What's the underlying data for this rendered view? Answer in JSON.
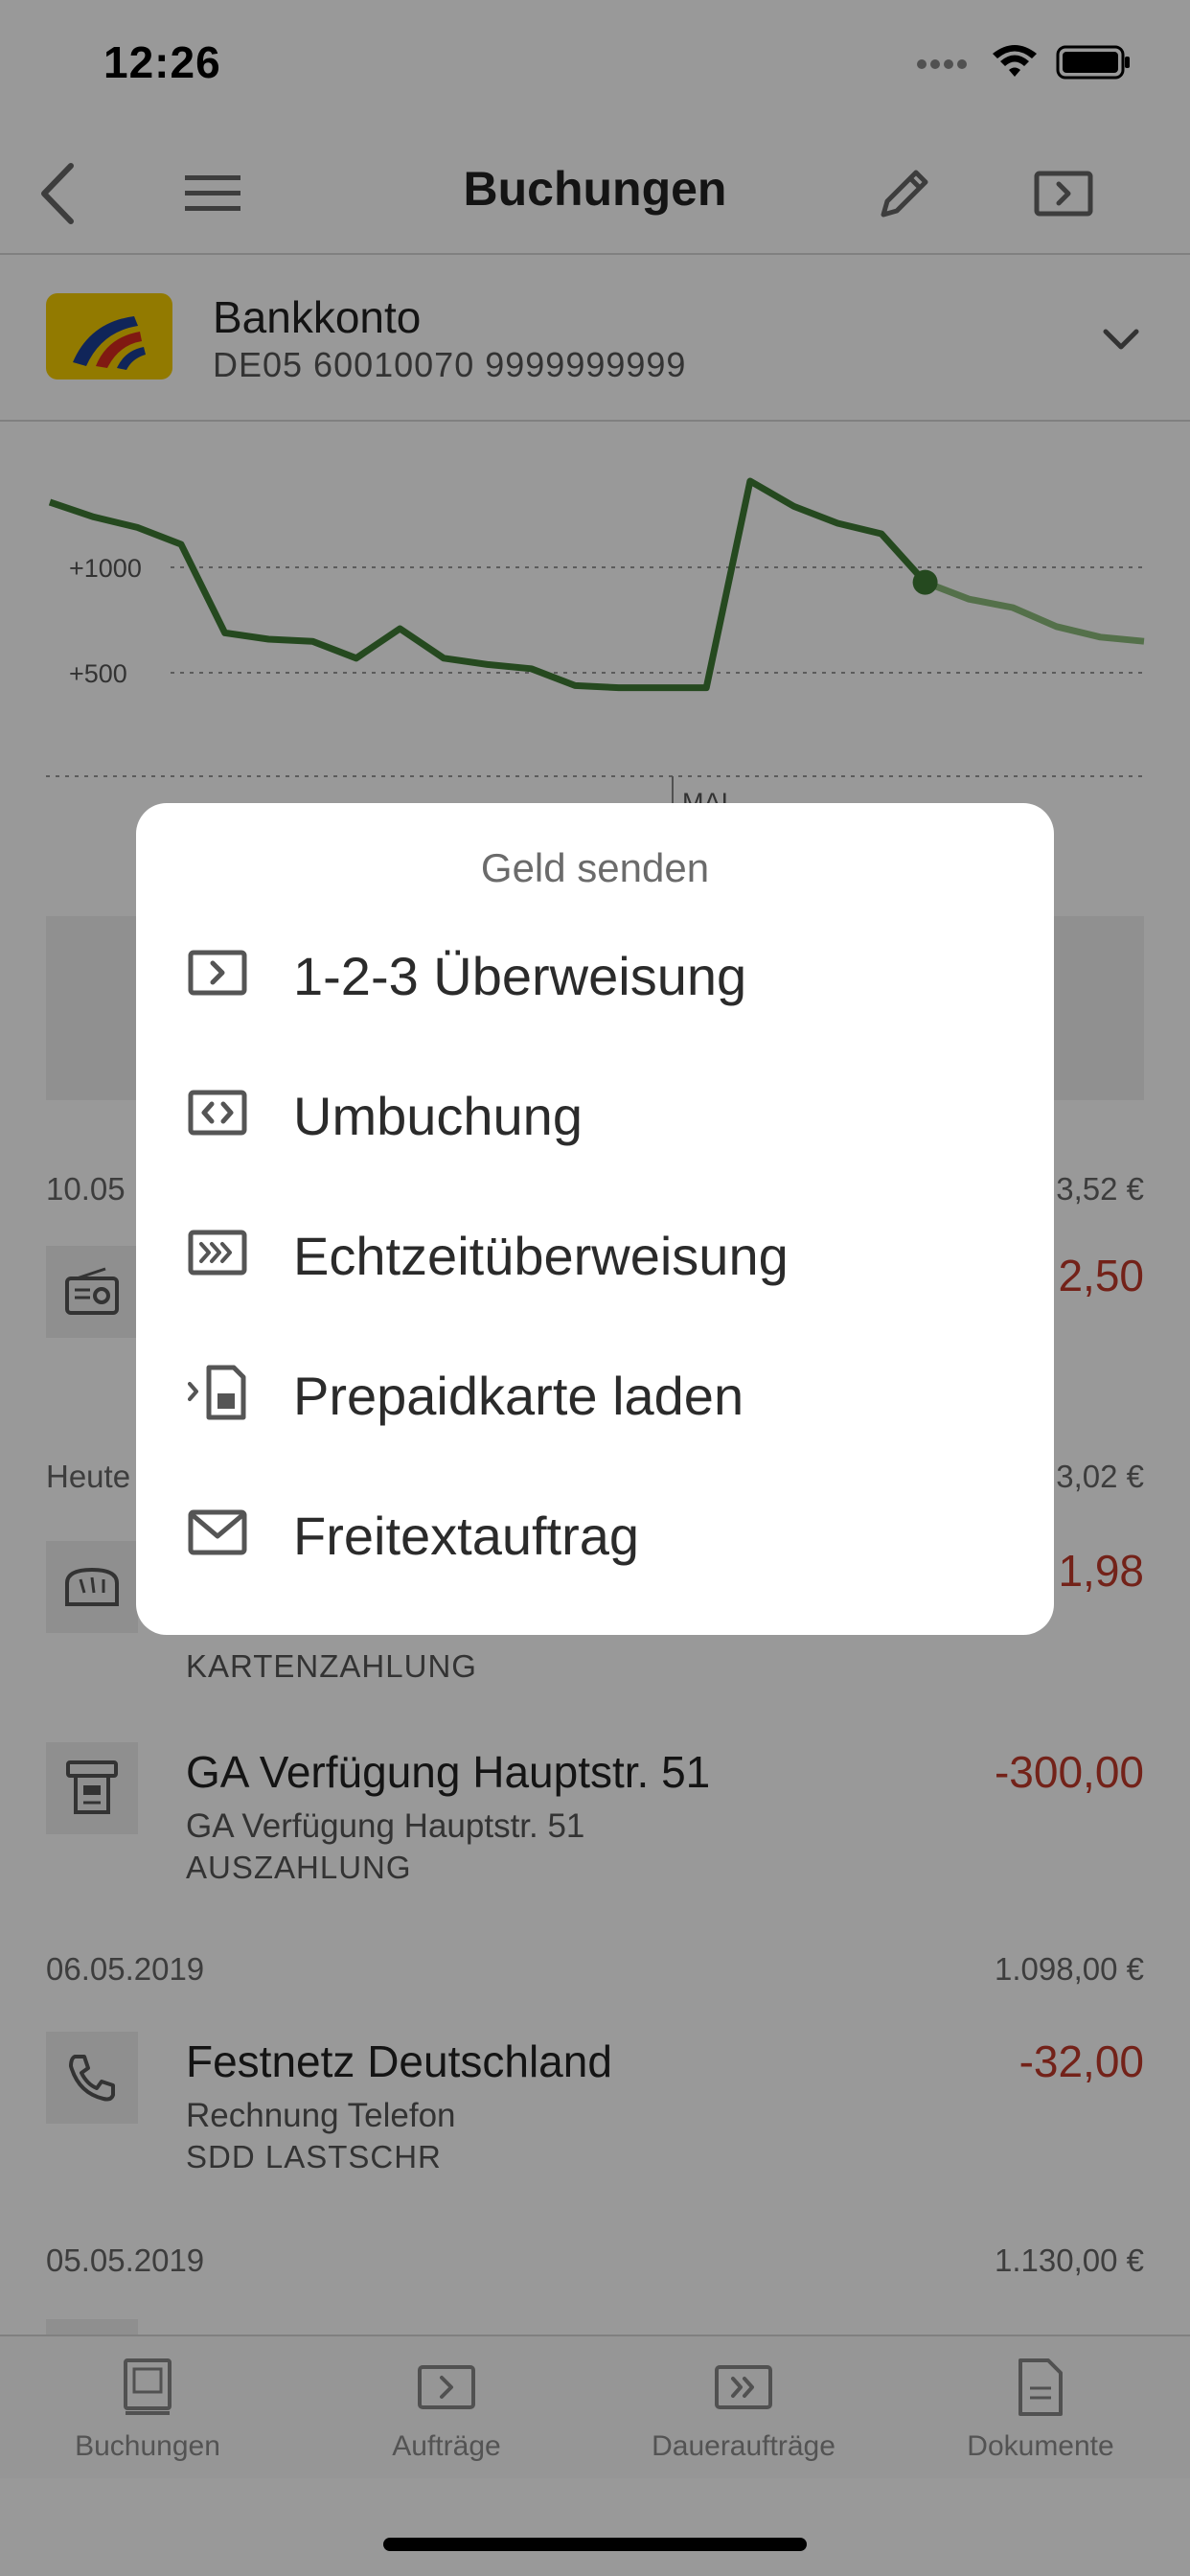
{
  "status_bar": {
    "time": "12:26"
  },
  "nav": {
    "title": "Buchungen"
  },
  "account": {
    "name": "Bankkonto",
    "iban": "DE05 60010070 9999999999"
  },
  "chart": {
    "ticks": [
      "+1000",
      "+500"
    ],
    "marker_label": "MAI"
  },
  "chart_data": {
    "type": "line",
    "title": "",
    "xlabel": "",
    "ylabel": "",
    "y_ticks": [
      1000,
      500
    ],
    "series": [
      {
        "values": [
          1300,
          1230,
          1180,
          1100,
          680,
          650,
          640,
          560,
          700,
          560,
          530,
          510,
          430,
          420,
          420,
          420,
          1400,
          1280,
          1200,
          1150,
          920,
          840,
          800,
          710,
          660,
          640
        ]
      }
    ]
  },
  "transactions_bg": {
    "groups": [
      {
        "date": "10.05",
        "sum": "3,52 €",
        "items": [
          {
            "amount": "2,50"
          }
        ]
      },
      {
        "date": "Heute",
        "sum": "3,02 €",
        "items": [
          {
            "amount": "1,98",
            "type": "KARTENZAHLUNG"
          }
        ]
      }
    ],
    "ga": {
      "title": "GA Verfügung Hauptstr. 51",
      "sub": "GA Verfügung Hauptstr. 51",
      "type": "AUSZAHLUNG",
      "amount": "-300,00"
    },
    "group3": {
      "date": "06.05.2019",
      "sum": "1.098,00 €"
    },
    "festnetz": {
      "title": "Festnetz Deutschland",
      "sub": "Rechnung Telefon",
      "type": "SDD LASTSCHR",
      "amount": "-32,00"
    },
    "group4": {
      "date": "05.05.2019",
      "sum": "1.130,00 €"
    }
  },
  "tabs": [
    {
      "label": "Buchungen",
      "icon": "book-icon"
    },
    {
      "label": "Aufträge",
      "icon": "transfer-icon"
    },
    {
      "label": "Daueraufträge",
      "icon": "standing-order-icon"
    },
    {
      "label": "Dokumente",
      "icon": "document-icon"
    }
  ],
  "sheet": {
    "title": "Geld senden",
    "items": [
      {
        "label": "1-2-3 Überweisung",
        "icon": "transfer-icon"
      },
      {
        "label": "Umbuchung",
        "icon": "rebooking-icon"
      },
      {
        "label": "Echtzeitüberweisung",
        "icon": "instant-transfer-icon"
      },
      {
        "label": "Prepaidkarte laden",
        "icon": "sim-card-icon"
      },
      {
        "label": "Freitextauftrag",
        "icon": "mail-icon"
      }
    ]
  },
  "colors": {
    "line_green": "#3f7a35",
    "line_green_light": "#8dbb7c",
    "amount_red": "#c0392b",
    "logo_yellow": "#f4cb00"
  }
}
